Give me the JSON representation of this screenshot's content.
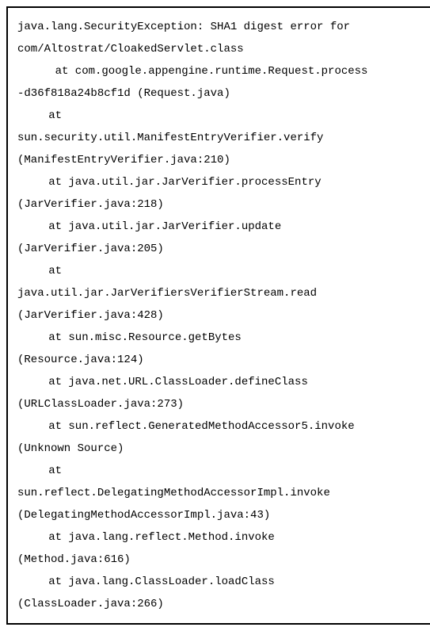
{
  "stacktrace": {
    "header_line1": "java.lang.SecurityException: SHA1 digest error for",
    "header_line2": "com/Altostrat/CloakedServlet.class",
    "frames": [
      {
        "at": "    at com.google.appengine.runtime.Request.process",
        "loc": "-d36f818a24b8cf1d (Request.java)"
      },
      {
        "at": "    at",
        "loc": "sun.security.util.ManifestEntryVerifier.verify",
        "loc2": "(ManifestEntryVerifier.java:210)"
      },
      {
        "at": "    at java.util.jar.JarVerifier.processEntry",
        "loc": "(JarVerifier.java:218)"
      },
      {
        "at": "    at java.util.jar.JarVerifier.update",
        "loc": "(JarVerifier.java:205)"
      },
      {
        "at": "    at",
        "loc": "java.util.jar.JarVerifiersVerifierStream.read",
        "loc2": "(JarVerifier.java:428)"
      },
      {
        "at": "    at sun.misc.Resource.getBytes",
        "loc": "(Resource.java:124)"
      },
      {
        "at": "    at java.net.URL.ClassLoader.defineClass",
        "loc": "(URLClassLoader.java:273)"
      },
      {
        "at": "    at sun.reflect.GeneratedMethodAccessor5.invoke",
        "loc": "(Unknown Source)"
      },
      {
        "at": "    at",
        "loc": "sun.reflect.DelegatingMethodAccessorImpl.invoke",
        "loc2": "(DelegatingMethodAccessorImpl.java:43)"
      },
      {
        "at": "    at java.lang.reflect.Method.invoke",
        "loc": "(Method.java:616)"
      },
      {
        "at": "    at java.lang.ClassLoader.loadClass",
        "loc": "(ClassLoader.java:266)"
      }
    ]
  }
}
